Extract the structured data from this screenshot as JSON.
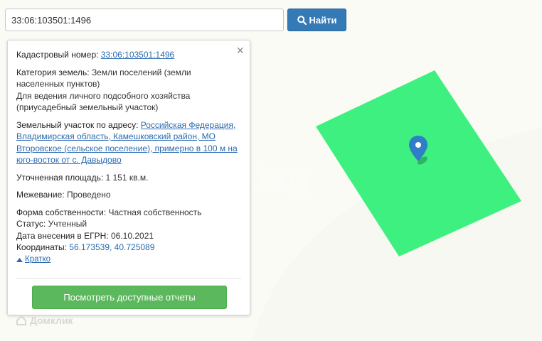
{
  "search": {
    "value": "33:06:103501:1496",
    "button_label": "Найти"
  },
  "popup": {
    "cadastral": {
      "label": "Кадастровый номер:",
      "value": "33:06:103501:1496"
    },
    "category": {
      "label": "Категория земель:",
      "value": "Земли поселений (земли населенных пунктов)",
      "usage": "Для ведения личного подсобного хозяйства (приусадебный земельный участок)"
    },
    "address": {
      "label": "Земельный участок по адресу:",
      "value": "Российская Федерация, Владимирская область, Камешковский район, МО Второвское (сельское поселение), примерно в 100 м на юго-восток от с. Давыдово"
    },
    "area": {
      "label": "Уточненная площадь:",
      "value": "1 151 кв.м."
    },
    "survey": {
      "label": "Межевание:",
      "value": "Проведено"
    },
    "ownership": {
      "label": "Форма собственности:",
      "value": "Частная собственность"
    },
    "status": {
      "label": "Статус:",
      "value": "Учтенный"
    },
    "date": {
      "label": "Дата внесения в ЕГРН:",
      "value": "06.10.2021"
    },
    "coordinates": {
      "label": "Координаты:",
      "value": "56.173539, 40.725089"
    },
    "toggle_label": "Кратко",
    "reports_button": "Посмотреть доступные отчеты"
  },
  "watermark": "Домклик",
  "colors": {
    "parcel": "#3ef07f",
    "primary": "#337ab7",
    "success": "#5cb85c",
    "link": "#2a6ab0",
    "pin": "#2f7ec6"
  }
}
